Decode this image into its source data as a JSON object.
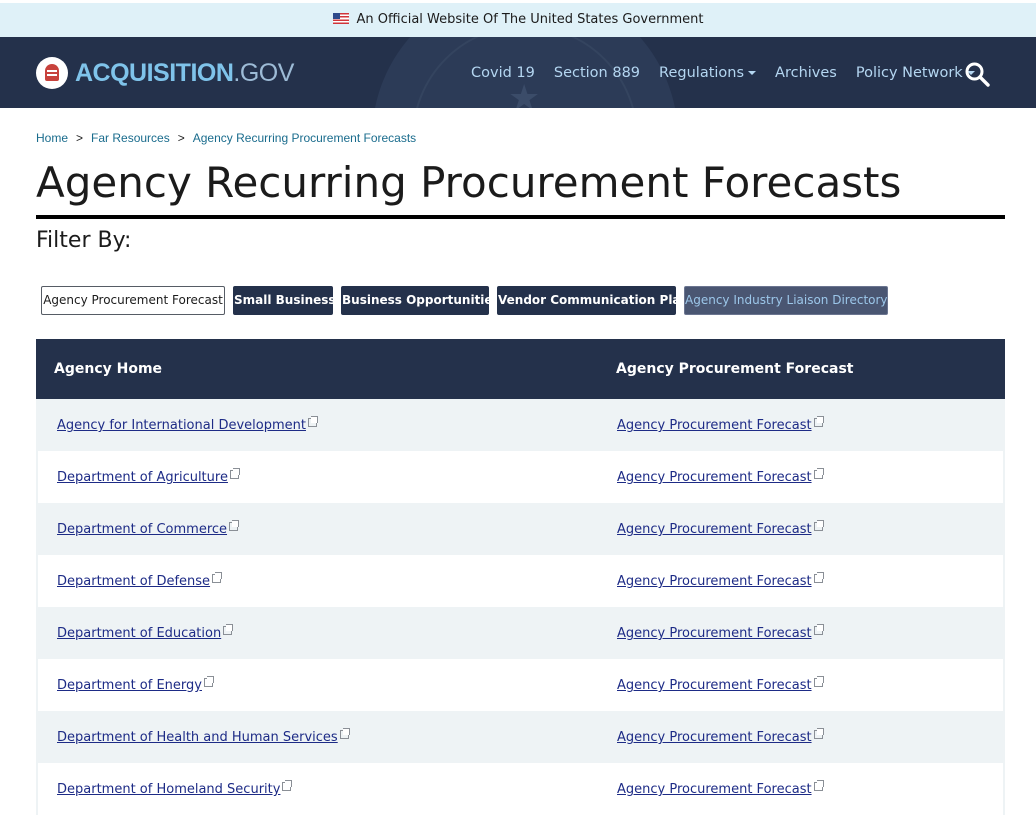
{
  "banner": {
    "text": "An Official Website Of The United States Government"
  },
  "header": {
    "logo_bold": "ACQUISITION",
    "logo_suffix": ".GOV",
    "nav": [
      "Covid 19",
      "Section 889",
      "Regulations",
      "Archives",
      "Policy Network"
    ]
  },
  "breadcrumb": {
    "home": "Home",
    "resources": "Far Resources",
    "current": "Agency Recurring Procurement Forecasts",
    "separator": ">"
  },
  "page": {
    "title": "Agency Recurring Procurement Forecasts",
    "filter_label": "Filter By:"
  },
  "filters": [
    "Agency Procurement Forecast",
    "Small Business",
    "Business Opportunities",
    "Vendor Communication Plan",
    "Agency Industry Liaison Directory"
  ],
  "table": {
    "headers": [
      "Agency Home",
      "Agency Procurement Forecast"
    ],
    "rows": [
      {
        "agency": "Agency for International Development",
        "forecast": "Agency Procurement Forecast"
      },
      {
        "agency": "Department of Agriculture",
        "forecast": "Agency Procurement Forecast"
      },
      {
        "agency": "Department of Commerce",
        "forecast": "Agency Procurement Forecast"
      },
      {
        "agency": "Department of Defense",
        "forecast": "Agency Procurement Forecast"
      },
      {
        "agency": "Department of Education",
        "forecast": "Agency Procurement Forecast"
      },
      {
        "agency": "Department of Energy",
        "forecast": "Agency Procurement Forecast"
      },
      {
        "agency": "Department of Health and Human Services",
        "forecast": "Agency Procurement Forecast"
      },
      {
        "agency": "Department of Homeland Security",
        "forecast": "Agency Procurement Forecast"
      }
    ]
  },
  "colors": {
    "nav_bg": "#24314b",
    "banner_bg": "#dff1f8",
    "link": "#1d2b86",
    "row_stripe": "#eef3f5"
  }
}
